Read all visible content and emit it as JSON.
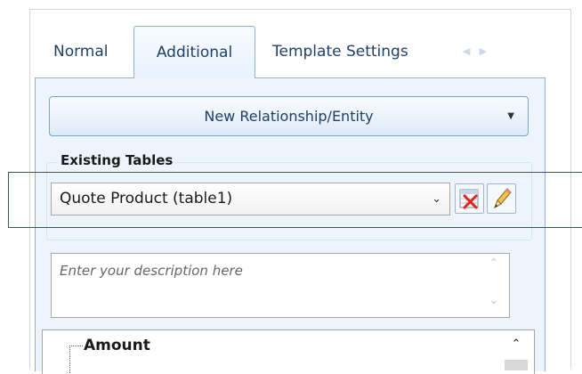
{
  "tabs": [
    {
      "label": "Normal"
    },
    {
      "label": "Additional",
      "active": true
    },
    {
      "label": "Template Settings"
    }
  ],
  "tab_scroll": {
    "left_icon": "triangle-left-icon",
    "right_icon": "triangle-right-icon"
  },
  "relationship": {
    "button_label": "New Relationship/Entity",
    "dropdown_icon": "triangle-down-icon"
  },
  "existing_tables": {
    "label": "Existing Tables",
    "selected": "Quote Product  (table1)",
    "delete_icon": "delete-table-icon",
    "edit_icon": "edit-pencil-icon"
  },
  "description": {
    "placeholder": "Enter your description here"
  },
  "tree": {
    "items": [
      {
        "label": "Amount"
      }
    ]
  },
  "colors": {
    "accent": "#8fb0d6",
    "panel_bg": "#eef4fb",
    "highlight": "#1f5c8e"
  }
}
